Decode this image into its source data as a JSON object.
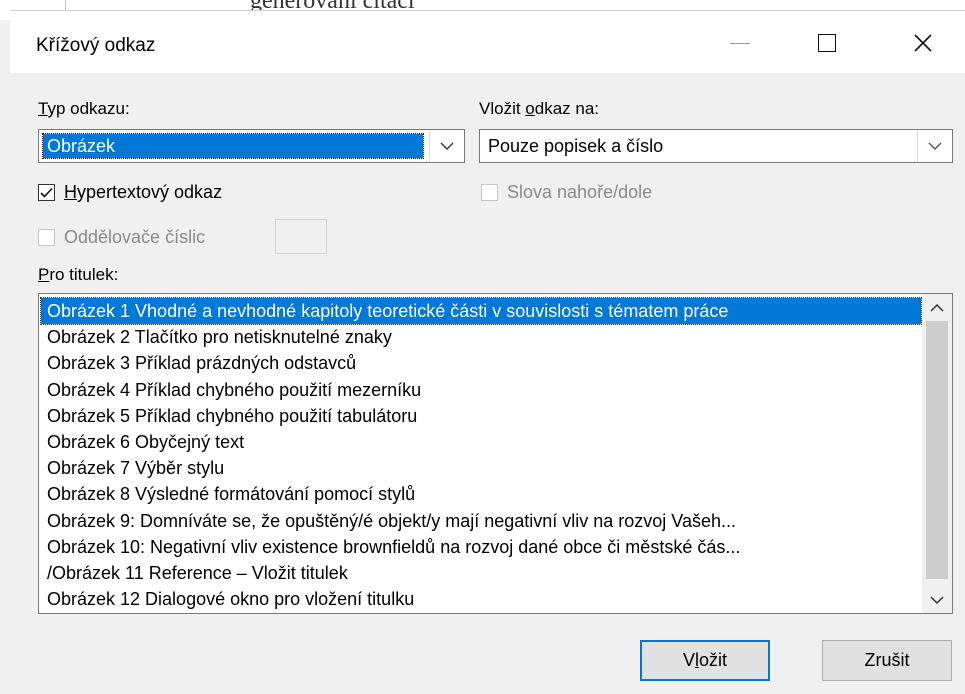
{
  "background": {
    "doc_text": "generovaní citací"
  },
  "dialog": {
    "title": "Křížový odkaz",
    "reference_type": {
      "label_underlined": "T",
      "label_rest": "yp odkazu:",
      "value": "Obrázek"
    },
    "insert_reference_to": {
      "label_start": "Vložit ",
      "label_underlined": "o",
      "label_rest": "dkaz na:",
      "value": "Pouze popisek a číslo"
    },
    "hyperlink": {
      "label_underlined": "H",
      "label_rest": "ypertextový odkaz",
      "checked": true
    },
    "above_below": {
      "label": "Slova nahoře/dole",
      "checked": false,
      "disabled": true
    },
    "number_separators": {
      "label": "Oddělovače číslic",
      "checked": false,
      "disabled": true
    },
    "for_caption": {
      "label_underlined": "P",
      "label_rest": "ro titulek:",
      "items": [
        "Obrázek 1 Vhodné a nevhodné kapitoly teoretické části v souvislosti s tématem práce",
        "Obrázek 2 Tlačítko pro netisknutelné znaky",
        "Obrázek 3 Příklad prázdných odstavců",
        "Obrázek 4 Příklad chybného použití mezerníku",
        "Obrázek 5 Příklad chybného použití tabulátoru",
        "Obrázek 6 Obyčejný text",
        "Obrázek 7 Výběr stylu",
        "Obrázek 8 Výsledné formátování pomocí stylů",
        "Obrázek 9: Domníváte se, že opuštěný/é objekt/y mají negativní vliv na rozvoj Vašeh...",
        "Obrázek 10: Negativní vliv existence brownfieldů na rozvoj dané obce či městské čás...",
        "/Obrázek 11 Reference – Vložit titulek",
        "Obrázek 12 Dialogové okno pro vložení titulku"
      ],
      "selected_index": 0
    },
    "buttons": {
      "insert_start": "V",
      "insert_underlined": "l",
      "insert_rest": "ožit",
      "cancel": "Zrušit"
    },
    "colors": {
      "accent": "#0078d7",
      "dialog_bg": "#f0f0f0"
    }
  }
}
